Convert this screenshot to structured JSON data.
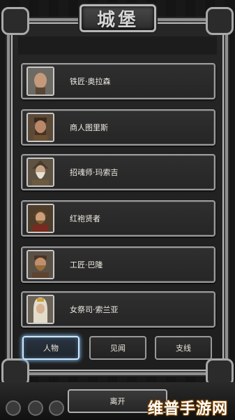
{
  "header": {
    "title": "城堡"
  },
  "characters": [
    {
      "name": "铁匠·奥拉森",
      "portrait": "bald-man-portrait-icon"
    },
    {
      "name": "商人图里斯",
      "portrait": "bearded-merchant-portrait-icon"
    },
    {
      "name": "招魂师·玛索吉",
      "portrait": "white-beard-necromancer-portrait-icon"
    },
    {
      "name": "红袍贤者",
      "portrait": "red-robe-sage-portrait-icon"
    },
    {
      "name": "工匠·巴隆",
      "portrait": "dwarf-craftsman-portrait-icon"
    },
    {
      "name": "女祭司·索兰亚",
      "portrait": "priestess-portrait-icon"
    }
  ],
  "tabs": [
    {
      "label": "人物",
      "active": true
    },
    {
      "label": "见闻",
      "active": false
    },
    {
      "label": "支线",
      "active": false
    }
  ],
  "bottom": {
    "leave_label": "离开"
  },
  "watermark": {
    "text": "维普手游网"
  },
  "colors": {
    "active_tab_glow": "#7fb6e6",
    "frame": "#9c9c9c"
  }
}
